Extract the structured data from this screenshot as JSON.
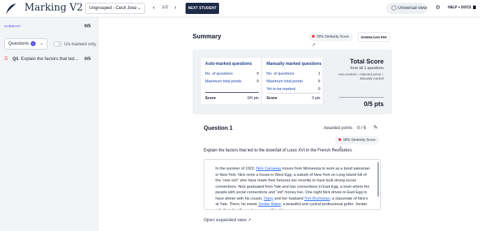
{
  "header": {
    "app_title": "Marking V2",
    "student_select": "Ungrouped - Cecil Jose",
    "pager": "1/2",
    "next_button": "NEXT STUDENT",
    "universal_view": "Universal view",
    "help_docs": "HELP + DOCS"
  },
  "sidebar": {
    "summary_label": "SUMMARY",
    "summary_score": "0/5",
    "filter_label": "Questions",
    "filter_count": "1",
    "unmarked_label": "Un-marked only",
    "questions": [
      {
        "num": "Q1",
        "text": "Explain the factors that led to the downfall of Louis XVI in the French Revolution.",
        "score": "0/5"
      }
    ]
  },
  "summary": {
    "title": "Summary",
    "similarity": "90%  Similarity Score",
    "download_label": "DOWNLOAD PDF",
    "auto": {
      "title": "Auto-marked questions",
      "rows": [
        {
          "label": "No. of questions",
          "value": "0"
        },
        {
          "label": "Maximum total points",
          "value": "0"
        }
      ],
      "score_label": "Score",
      "score_value": "0/0 pts"
    },
    "manual": {
      "title": "Manually marked questions",
      "rows": [
        {
          "label": "No. of questions",
          "value": "1"
        },
        {
          "label": "Maximum total points",
          "value": "5"
        },
        {
          "label": "Yet to be marked",
          "value": "0"
        }
      ],
      "score_label": "Score",
      "score_value": "0 pts"
    },
    "total": {
      "title": "Total Score",
      "sub": "from all 1 questions",
      "note": "Auto-marked + Adjusted points + Manually marked",
      "score": "0/5 pts"
    }
  },
  "question": {
    "title": "Question 1",
    "awarded_label": "Awarded points",
    "awarded_value": "0 / 5",
    "similarity": "90%  Similarity Score",
    "text": "Explain the factors that led to the downfall of Louis XVI in the French Revolution.",
    "answer_parts": [
      {
        "t": "In the summer of 1922, "
      },
      {
        "t": "Nick Carraway",
        "link": true
      },
      {
        "t": " moves from Minnesota to work as a bond salesman in New York. Nick rents a house in West Egg, a suburb of New York on Long Island full of the “new rich” who have made their fortunes too recently to have built strong social connections. Nick graduated from Yale and has connections in East Egg, a town where the people with social connections and “old” money live. One night Nick drives to East Egg to have dinner with his cousin, "
      },
      {
        "t": "Daisy",
        "link": true
      },
      {
        "t": " and her husband "
      },
      {
        "t": "Tom Buchanan",
        "link": true
      },
      {
        "t": ", a classmate of Nick’s at Yale. There, he meets "
      },
      {
        "t": "Jordan Baker",
        "link": true
      },
      {
        "t": ", a beautiful and cynical professional golfer. Jordan tells Nick that Tom is having an affair. Upon"
      }
    ],
    "expand_label": "Open expanded view"
  },
  "colors": {
    "brand_navy": "#1e2a46",
    "accent_indigo": "#4f46e5",
    "link_blue": "#2563eb",
    "alert_red": "#ef4444"
  }
}
